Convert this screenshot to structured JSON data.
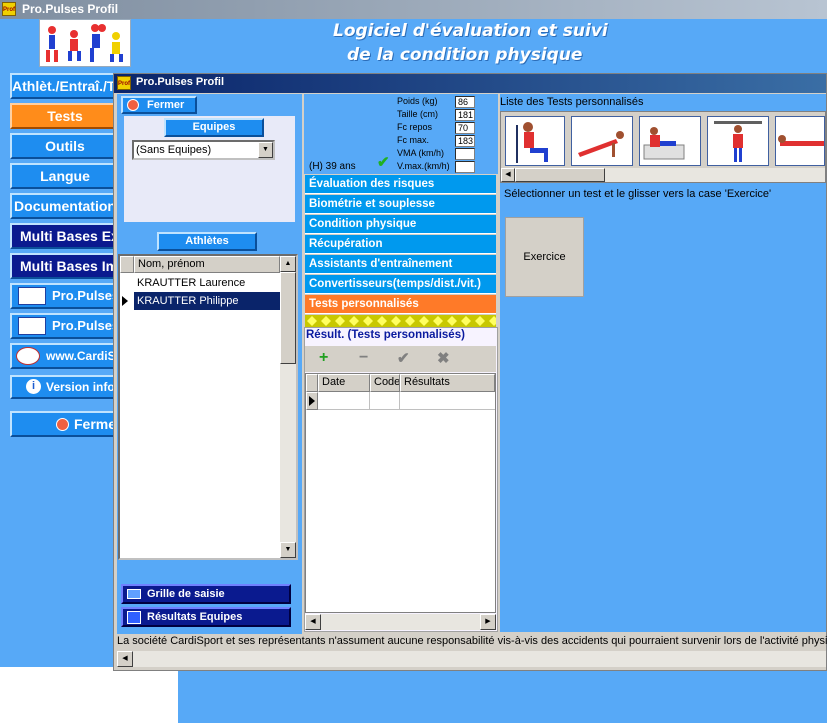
{
  "app": {
    "title": "Pro.Pulses Profil",
    "header_line1": "Logiciel d'évaluation et suivi",
    "header_line2": "de la condition physique",
    "icon_text": "Profil"
  },
  "left_menu": [
    {
      "label": "Athlèt./Entraî./Tests"
    },
    {
      "label": "Tests"
    },
    {
      "label": "Outils"
    },
    {
      "label": "Langue"
    },
    {
      "label": "Documentation"
    },
    {
      "label": "Multi Bases Export"
    },
    {
      "label": "Multi Bases Import"
    },
    {
      "label": "Pro.Pulses"
    },
    {
      "label": "Pro.Pulses"
    },
    {
      "label": "www.CardiSport"
    },
    {
      "label": "Version info"
    },
    {
      "label": "Fermer"
    }
  ],
  "window": {
    "title": "Pro.Pulses Profil",
    "close_label": "Fermer",
    "teams_label": "Equipes",
    "teams_value": "(Sans Equipes)",
    "athletes_label": "Athlètes",
    "athletes_header": "Nom, prénom",
    "athletes": [
      "KRAUTTER Laurence",
      "KRAUTTER Philippe"
    ],
    "grid_button": "Grille de saisie",
    "results_button": "Résultats Equipes"
  },
  "stats": {
    "age": "(H) 39 ans",
    "rows": [
      {
        "label": "Poids (kg)",
        "value": "86"
      },
      {
        "label": "Taille (cm)",
        "value": "181"
      },
      {
        "label": "Fc repos",
        "value": "70"
      },
      {
        "label": "Fc max.",
        "value": "183"
      },
      {
        "label": "VMA (km/h)",
        "value": ""
      },
      {
        "label": "V.max.(km/h)",
        "value": ""
      }
    ]
  },
  "categories": [
    "Évaluation des risques",
    "Biométrie et souplesse",
    "Condition physique",
    "Récupération",
    "Assistants d'entraînement",
    "Convertisseurs(temps/dist./vit.)",
    "Tests personnalisés"
  ],
  "results": {
    "title": "Résult. (Tests personnalisés)",
    "columns": [
      "Date",
      "Code",
      "Résultats"
    ]
  },
  "tests_panel": {
    "title": "Liste des Tests personnalisés",
    "instruction": "Sélectionner un test et le glisser vers la case 'Exercice'",
    "exercise_label": "Exercice"
  },
  "footer": {
    "disclaimer": "La société CardiSport et ses représentants n'assument aucune responsabilité vis-à-vis  des accidents  qui pourraient survenir lors de l'activité physique."
  },
  "colors": {
    "accent_blue": "#1e8df0",
    "selected_orange": "#ff8c1a",
    "dark_navy": "#0a1a8f",
    "background_blue": "#57a9f7"
  }
}
